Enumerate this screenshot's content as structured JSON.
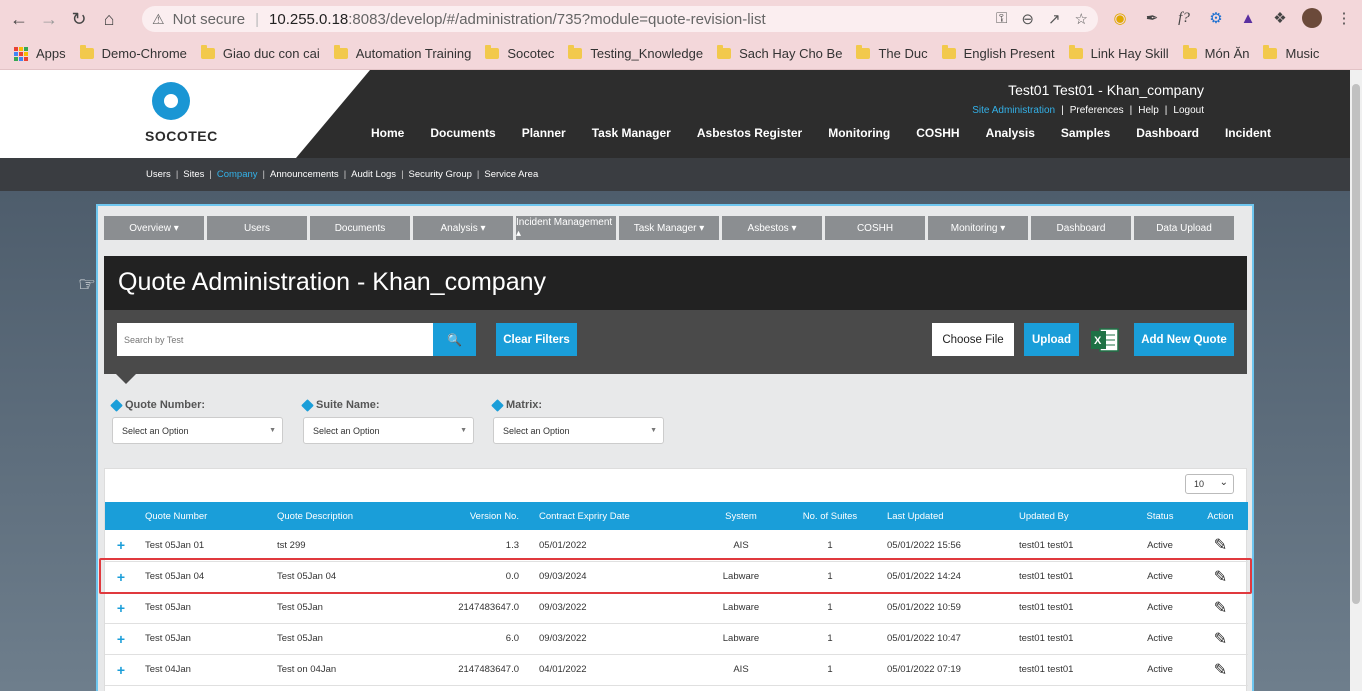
{
  "browser": {
    "security_label": "Not secure",
    "url_host": "10.255.0.18",
    "url_rest": ":8083/develop/#/administration/735?module=quote-revision-list",
    "bookmarks": [
      "Apps",
      "Demo-Chrome",
      "Giao duc con cai",
      "Automation Training",
      "Socotec",
      "Testing_Knowledge",
      "Sach Hay Cho Be",
      "The Duc",
      "English Present",
      "Link Hay Skill",
      "Món Ăn",
      "Music"
    ]
  },
  "header": {
    "brand": "SOCOTEC",
    "user": "Test01 Test01 - Khan_company",
    "top_links": [
      "Site Administration",
      "Preferences",
      "Help",
      "Logout"
    ],
    "nav": [
      "Home",
      "Documents",
      "Planner",
      "Task Manager",
      "Asbestos Register",
      "Monitoring",
      "COSHH",
      "Analysis",
      "Samples",
      "Dashboard",
      "Incident"
    ],
    "sub_nav": [
      "Users",
      "Sites",
      "Company",
      "Announcements",
      "Audit Logs",
      "Security Group",
      "Service Area"
    ]
  },
  "tabs": [
    "Overview ▾",
    "Users",
    "Documents",
    "Analysis ▾",
    "Incident Management ▴",
    "Task Manager ▾",
    "Asbestos ▾",
    "COSHH",
    "Monitoring ▾",
    "Dashboard",
    "Data Upload"
  ],
  "page": {
    "title": "Quote Administration - Khan_company",
    "search_placeholder": "Search by Test",
    "clear_filters": "Clear Filters",
    "choose_file": "Choose File",
    "upload": "Upload",
    "add_new_quote": "Add New Quote"
  },
  "filters": [
    {
      "label": "Quote Number:",
      "value": "Select an Option"
    },
    {
      "label": "Suite Name:",
      "value": "Select an Option"
    },
    {
      "label": "Matrix:",
      "value": "Select an Option"
    }
  ],
  "table": {
    "page_size": "10",
    "headers": [
      "Quote Number",
      "Quote Description",
      "Version No.",
      "Contract Expriry Date",
      "System",
      "No. of Suites",
      "Last Updated",
      "Updated By",
      "Status",
      "Action"
    ],
    "rows": [
      [
        "Test 05Jan 01",
        "tst 299",
        "1.3",
        "05/01/2022",
        "AIS",
        "1",
        "05/01/2022 15:56",
        "test01 test01",
        "Active"
      ],
      [
        "Test 05Jan 04",
        "Test 05Jan 04",
        "0.0",
        "09/03/2024",
        "Labware",
        "1",
        "05/01/2022 14:24",
        "test01 test01",
        "Active"
      ],
      [
        "Test 05Jan",
        "Test 05Jan",
        "2147483647.0",
        "09/03/2022",
        "Labware",
        "1",
        "05/01/2022 10:59",
        "test01 test01",
        "Active"
      ],
      [
        "Test 05Jan",
        "Test 05Jan",
        "6.0",
        "09/03/2022",
        "Labware",
        "1",
        "05/01/2022 10:47",
        "test01 test01",
        "Active"
      ],
      [
        "Test 04Jan",
        "Test on 04Jan",
        "2147483647.0",
        "04/01/2022",
        "AIS",
        "1",
        "05/01/2022 07:19",
        "test01 test01",
        "Active"
      ]
    ]
  }
}
